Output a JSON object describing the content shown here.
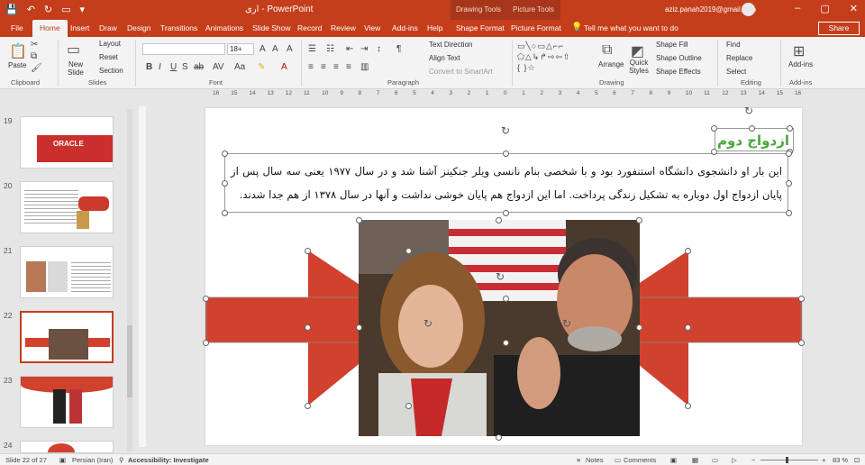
{
  "titlebar": {
    "doc_name": "اری  -  PowerPoint",
    "drawing_tools": "Drawing Tools",
    "picture_tools": "Picture Tools",
    "account_email": "aziz.panah2019@gmail.com",
    "window_buttons": [
      "–",
      "▢",
      "✕"
    ]
  },
  "tabs": [
    {
      "label": "File",
      "active": false
    },
    {
      "label": "Home",
      "active": true
    },
    {
      "label": "Insert",
      "active": false
    },
    {
      "label": "Draw",
      "active": false
    },
    {
      "label": "Design",
      "active": false
    },
    {
      "label": "Transitions",
      "active": false
    },
    {
      "label": "Animations",
      "active": false
    },
    {
      "label": "Slide Show",
      "active": false
    },
    {
      "label": "Record",
      "active": false
    },
    {
      "label": "Review",
      "active": false
    },
    {
      "label": "View",
      "active": false
    },
    {
      "label": "Add-ins",
      "active": false
    },
    {
      "label": "Help",
      "active": false
    },
    {
      "label": "Shape Format",
      "active": false
    },
    {
      "label": "Picture Format",
      "active": false
    }
  ],
  "tell_me": "Tell me what you want to do",
  "share_label": "Share",
  "ribbon": {
    "clipboard": {
      "paste": "Paste",
      "label": "Clipboard"
    },
    "slides": {
      "new_slide": "New Slide",
      "layout": "Layout",
      "reset": "Reset",
      "section": "Section",
      "label": "Slides"
    },
    "font": {
      "font_size": "18+",
      "label": "Font"
    },
    "paragraph": {
      "text_direction": "Text Direction",
      "align_text": "Align Text",
      "convert_smartart": "Convert to SmartArt",
      "label": "Paragraph"
    },
    "drawing": {
      "arrange": "Arrange",
      "quick_styles": "Quick Styles",
      "shape_fill": "Shape Fill",
      "shape_outline": "Shape Outline",
      "shape_effects": "Shape Effects",
      "label": "Drawing"
    },
    "editing": {
      "find": "Find",
      "replace": "Replace",
      "select": "Select",
      "label": "Editing"
    },
    "addins": {
      "addins": "Add-ins",
      "label": "Add-ins"
    }
  },
  "ruler_ticks": [
    "16",
    "15",
    "14",
    "13",
    "12",
    "11",
    "10",
    "9",
    "8",
    "7",
    "6",
    "5",
    "4",
    "3",
    "2",
    "1",
    "0",
    "1",
    "2",
    "3",
    "4",
    "5",
    "6",
    "7",
    "8",
    "9",
    "10",
    "11",
    "12",
    "13",
    "14",
    "15",
    "16"
  ],
  "slides_panel": [
    {
      "num": "19",
      "selected": false,
      "logo": "ORACLE"
    },
    {
      "num": "20",
      "selected": false
    },
    {
      "num": "21",
      "selected": false
    },
    {
      "num": "22",
      "selected": true
    },
    {
      "num": "23",
      "selected": false
    },
    {
      "num": "24",
      "selected": false
    }
  ],
  "slide": {
    "title": "ازدواج دوم",
    "body": "این بار او دانشجوی دانشگاه استنفورد بود و با شخصی بنام نانسی ویلر جنکینز آشنا شد و در سال ۱۹۷۷ یعنی سه سال پس از پایان ازدواج اول دوباره به تشکیل زندگی پرداخت. اما این ازدواج هم پایان خوشی نداشت و آنها در سال ۱۳۷۸ از هم جدا شدند.",
    "colors": {
      "accent_red": "#d0412e",
      "title_green": "#4aa83b"
    }
  },
  "status": {
    "slide_info": "Slide 22 of 27",
    "language": "Persian (Iran)",
    "accessibility": "Accessibility: Investigate",
    "notes": "Notes",
    "comments": "Comments",
    "zoom": "83 %"
  }
}
